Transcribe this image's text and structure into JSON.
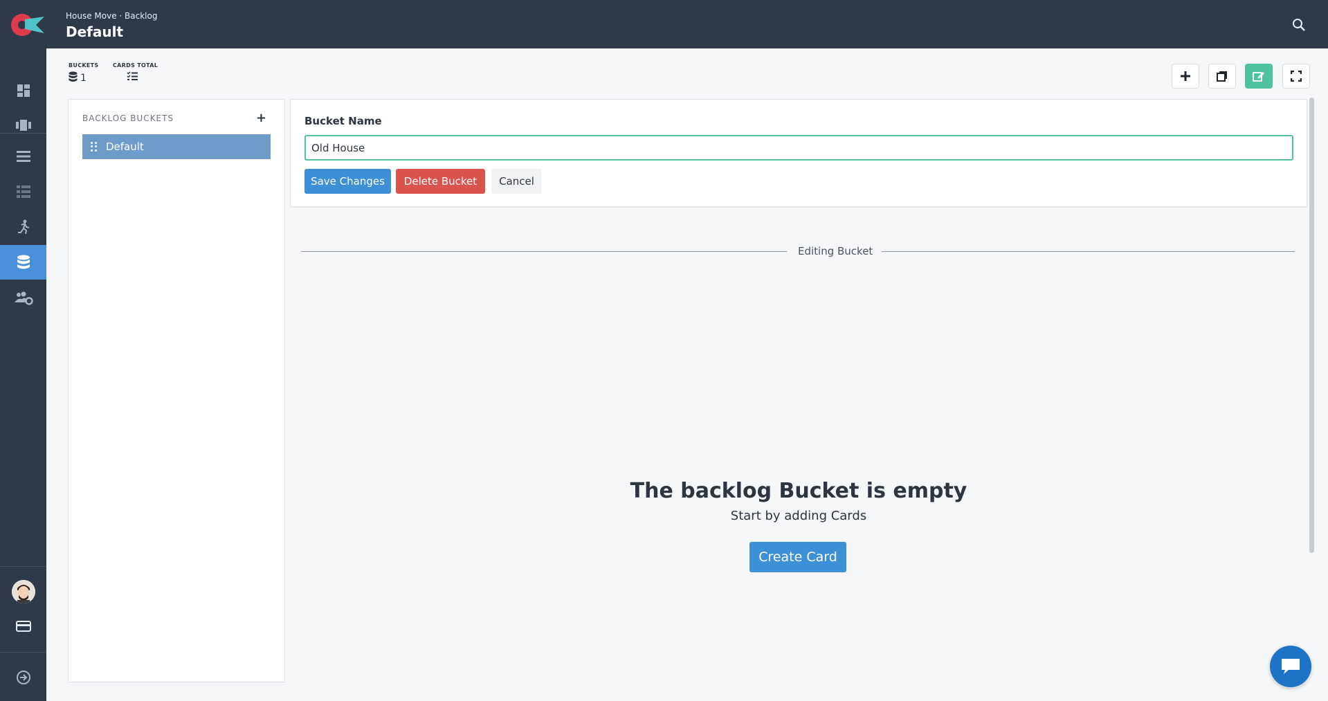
{
  "header": {
    "breadcrumb": "House Move · Backlog",
    "title": "Default"
  },
  "stats": {
    "buckets_label": "BUCKETS",
    "buckets_value": "1",
    "cards_label": "CARDS TOTAL",
    "cards_value": ""
  },
  "sidebar": {
    "items": [
      {
        "icon": "dashboard-icon"
      },
      {
        "icon": "board-icon"
      },
      {
        "icon": "list-icon"
      },
      {
        "icon": "table-icon"
      },
      {
        "icon": "sprint-runner-icon"
      },
      {
        "icon": "database-icon",
        "active": true
      },
      {
        "icon": "team-settings-icon"
      }
    ],
    "bottom": [
      {
        "icon": "user-avatar"
      },
      {
        "icon": "billing-card-icon"
      },
      {
        "icon": "logout-icon"
      }
    ]
  },
  "buckets_panel": {
    "header": "BACKLOG BUCKETS",
    "add_label": "+",
    "items": [
      {
        "label": "Default",
        "active": true
      }
    ]
  },
  "edit_form": {
    "field_label": "Bucket Name",
    "input_value": "Old House",
    "save_label": "Save Changes",
    "delete_label": "Delete Bucket",
    "cancel_label": "Cancel"
  },
  "divider": {
    "label": "Editing Bucket"
  },
  "empty_state": {
    "title": "The backlog Bucket is empty",
    "subtitle": "Start by adding Cards",
    "button_label": "Create Card"
  },
  "colors": {
    "topbar": "#2f3a48",
    "active_nav": "#4a90d9",
    "primary": "#3d8fd6",
    "danger": "#d9534f",
    "teal": "#4fc3a1",
    "bucket_active": "#6e9bc9"
  }
}
